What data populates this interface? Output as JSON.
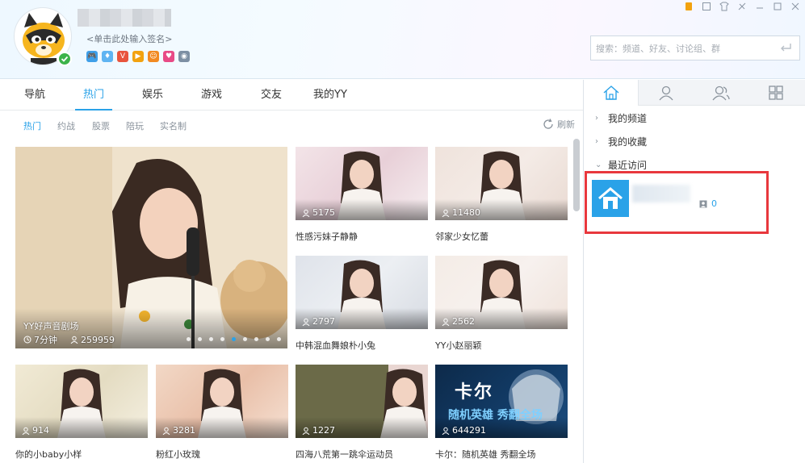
{
  "profile": {
    "signature": "<单击此处输入签名>",
    "avatar_icon": "raccoon-mascot-icon",
    "badges": [
      {
        "name": "game-icon",
        "color": "#3f9fe8",
        "glyph": "🎮"
      },
      {
        "name": "diamond-icon",
        "color": "#5fb4f2",
        "glyph": "♦"
      },
      {
        "name": "vip-icon",
        "color": "#e8543d",
        "glyph": "V"
      },
      {
        "name": "video-icon",
        "color": "#f2a20f",
        "glyph": "▶"
      },
      {
        "name": "face-icon",
        "color": "#f28a22",
        "glyph": "☺"
      },
      {
        "name": "heart-icon",
        "color": "#e84a86",
        "glyph": "♥"
      },
      {
        "name": "eye-icon",
        "color": "#7d8fa3",
        "glyph": "◉"
      }
    ]
  },
  "search": {
    "placeholder": "搜索：频道、好友、讨论组、群"
  },
  "main_tabs": [
    "导航",
    "热门",
    "娱乐",
    "游戏",
    "交友",
    "我的YY"
  ],
  "active_main_tab": "热门",
  "sub_tabs": [
    "热门",
    "约战",
    "股票",
    "陪玩",
    "实名制"
  ],
  "refresh_label": "刷新",
  "featured": {
    "title": "YY好声音剧场",
    "duration": "7分钟",
    "viewers": "259959",
    "slide_count": 9,
    "active_slide": 4
  },
  "cards": [
    {
      "viewers": "5175",
      "title": "性感污妹子静静"
    },
    {
      "viewers": "11480",
      "title": "邻家少女忆蕾"
    },
    {
      "viewers": "2797",
      "title": "中韩混血舞娘朴小兔"
    },
    {
      "viewers": "2562",
      "title": "YY小赵丽颖"
    },
    {
      "viewers": "914",
      "title": "你的小baby小样"
    },
    {
      "viewers": "3281",
      "title": "粉红小玫瑰"
    },
    {
      "viewers": "1227",
      "title": "四海八荒第一跳伞运动员"
    },
    {
      "viewers": "644291",
      "title": "卡尔：随机英雄 秀翻全场"
    }
  ],
  "card_overlay": {
    "headline": "卡尔",
    "subline": "随机英雄 秀翻全场"
  },
  "right_panel": {
    "tabs": [
      "home-icon",
      "friend-icon",
      "group-icon",
      "apps-icon"
    ],
    "tree": [
      "我的频道",
      "我的收藏",
      "最近访问"
    ],
    "recent": {
      "count": "0"
    }
  },
  "colors": {
    "accent": "#2aa2e8",
    "highlight": "#e8383d"
  }
}
